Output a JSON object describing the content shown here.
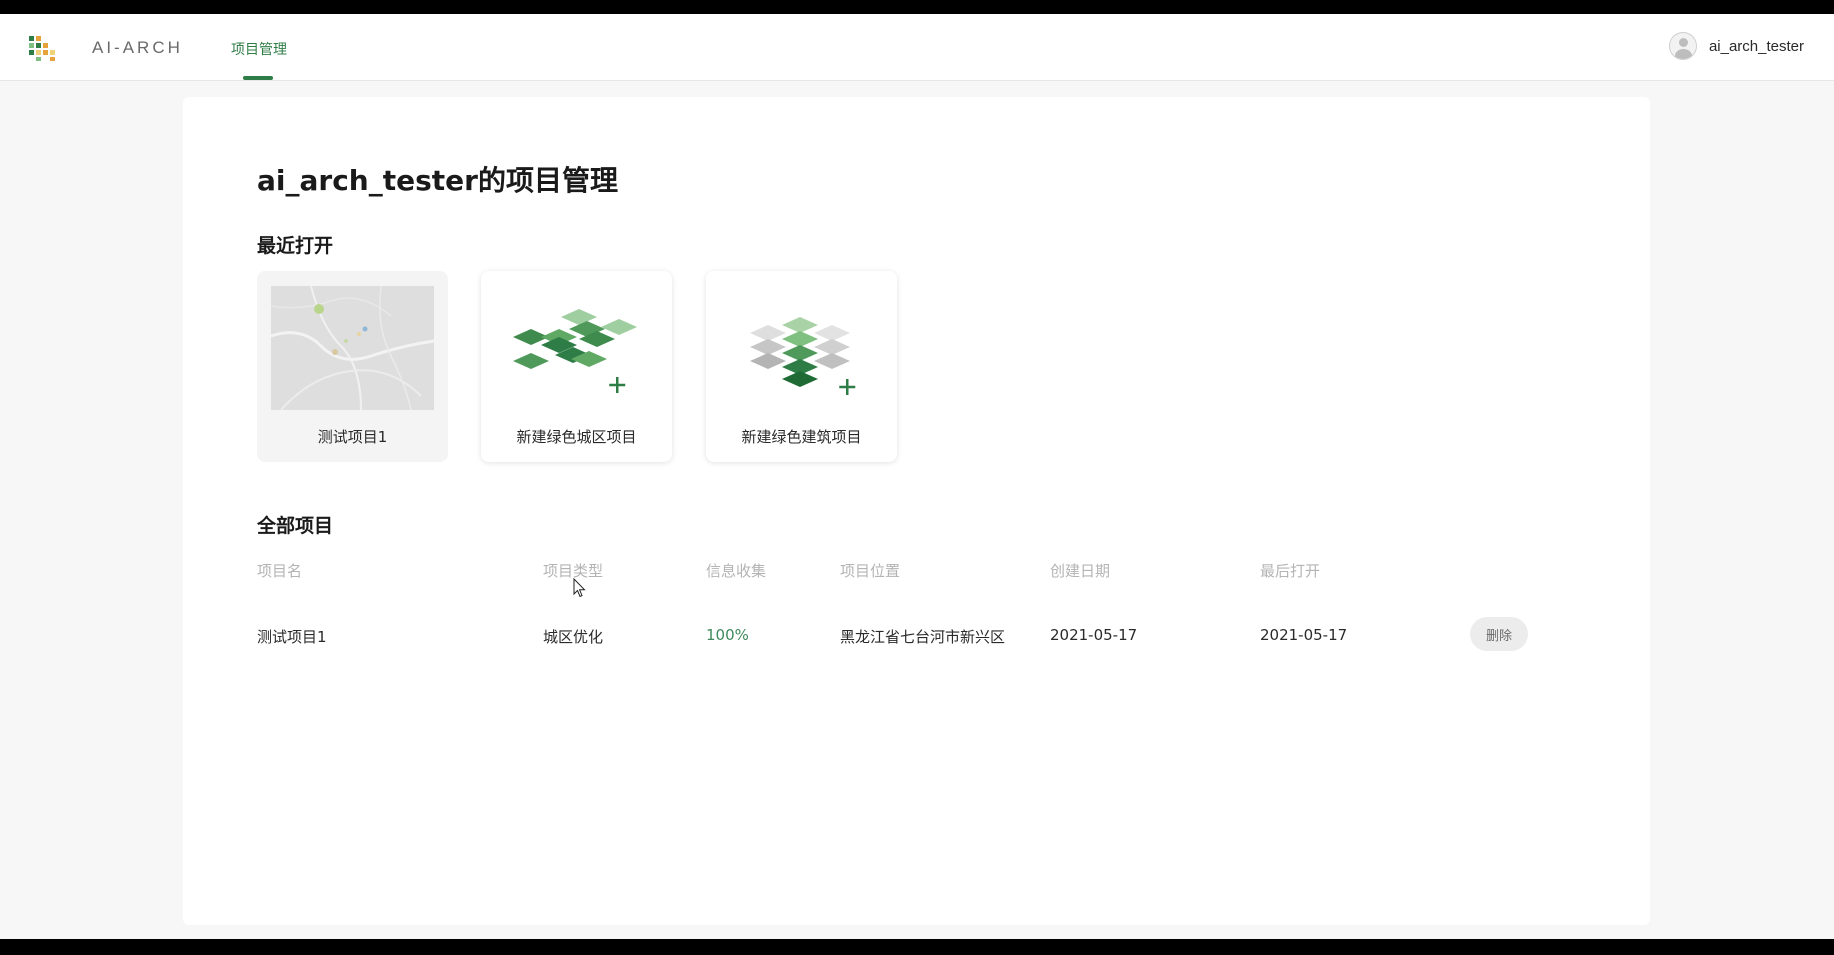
{
  "header": {
    "logo_text": "AI-ARCH",
    "nav_tab": "项目管理",
    "username": "ai_arch_tester"
  },
  "main": {
    "title": "ai_arch_tester的项目管理",
    "recent_heading": "最近打开",
    "all_heading": "全部项目",
    "recent_cards": [
      {
        "label": "测试项目1",
        "icon": "map-thumbnail"
      },
      {
        "label": "新建绿色城区项目",
        "icon": "green-district-plus-icon"
      },
      {
        "label": "新建绿色建筑项目",
        "icon": "green-building-plus-icon"
      }
    ],
    "table": {
      "columns": [
        "项目名",
        "项目类型",
        "信息收集",
        "项目位置",
        "创建日期",
        "最后打开"
      ],
      "rows": [
        {
          "name": "测试项目1",
          "type": "城区优化",
          "progress": "100%",
          "location": "黑龙江省七台河市新兴区",
          "created": "2021-05-17",
          "last_opened": "2021-05-17",
          "action": "删除"
        }
      ]
    }
  },
  "colors": {
    "accent": "#2f7d46",
    "progress_text": "#3f8a5d",
    "panel_bg": "#ffffff",
    "page_bg": "#f7f7f7"
  }
}
